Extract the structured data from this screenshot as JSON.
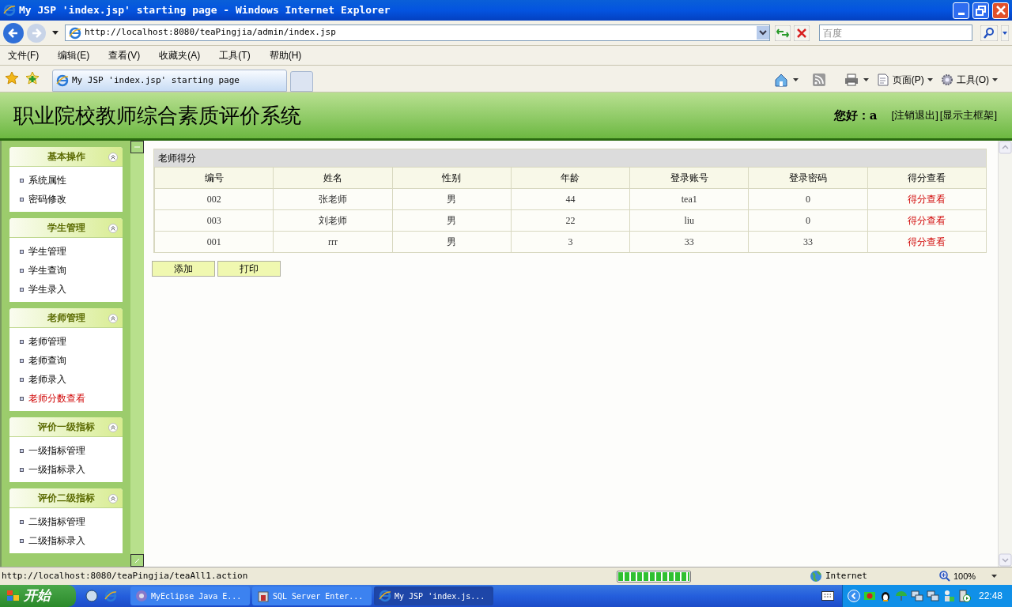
{
  "window": {
    "title": "My JSP 'index.jsp' starting page - Windows Internet Explorer"
  },
  "browser": {
    "address": "http://localhost:8080/teaPingjia/admin/index.jsp",
    "search_placeholder": "百度",
    "menu": [
      "文件(F)",
      "编辑(E)",
      "查看(V)",
      "收藏夹(A)",
      "工具(T)",
      "帮助(H)"
    ],
    "tabs": [
      {
        "label": "My JSP 'index.jsp' starting page",
        "selected": true
      }
    ],
    "commands": [
      "页面(P)",
      "工具(O)"
    ]
  },
  "page": {
    "title": "职业院校教师综合素质评价系统",
    "greeting": "您好：",
    "user": "a",
    "links": [
      "[注销退出]",
      "[显示主框架]"
    ],
    "sidebar": [
      {
        "title": "基本操作",
        "items": [
          {
            "label": "系统属性",
            "selected": false
          },
          {
            "label": "密码修改",
            "selected": false
          }
        ]
      },
      {
        "title": "学生管理",
        "items": [
          {
            "label": "学生管理",
            "selected": false
          },
          {
            "label": "学生查询",
            "selected": false
          },
          {
            "label": "学生录入",
            "selected": false
          }
        ]
      },
      {
        "title": "老师管理",
        "items": [
          {
            "label": "老师管理",
            "selected": false
          },
          {
            "label": "老师查询",
            "selected": false
          },
          {
            "label": "老师录入",
            "selected": false
          },
          {
            "label": "老师分数查看",
            "selected": true
          }
        ]
      },
      {
        "title": "评价一级指标",
        "items": [
          {
            "label": "一级指标管理",
            "selected": false
          },
          {
            "label": "一级指标录入",
            "selected": false
          }
        ]
      },
      {
        "title": "评价二级指标",
        "items": [
          {
            "label": "二级指标管理",
            "selected": false
          },
          {
            "label": "二级指标录入",
            "selected": false
          }
        ]
      }
    ],
    "table": {
      "title": "老师得分",
      "columns": [
        "编号",
        "姓名",
        "性别",
        "年龄",
        "登录账号",
        "登录密码",
        "得分查看"
      ],
      "rows": [
        [
          "002",
          "张老师",
          "男",
          "44",
          "tea1",
          "0",
          "得分查看"
        ],
        [
          "003",
          "刘老师",
          "男",
          "22",
          "liu",
          "0",
          "得分查看"
        ],
        [
          "001",
          "rrr",
          "男",
          "3",
          "33",
          "33",
          "得分查看"
        ]
      ]
    },
    "buttons": [
      "添加",
      "打印"
    ]
  },
  "status_bar": {
    "url": "http://localhost:8080/teaPingjia/teaAll1.action",
    "progress": {
      "level": 1
    },
    "zone": "Internet",
    "zoom": "100%"
  },
  "taskbar": {
    "start": "开始",
    "tasks": [
      {
        "label": "MyEclipse Java E...",
        "selected": false
      },
      {
        "label": "SQL Server Enter...",
        "selected": false
      },
      {
        "label": "My JSP 'index.js...",
        "selected": true
      }
    ],
    "clock": "22:48"
  }
}
